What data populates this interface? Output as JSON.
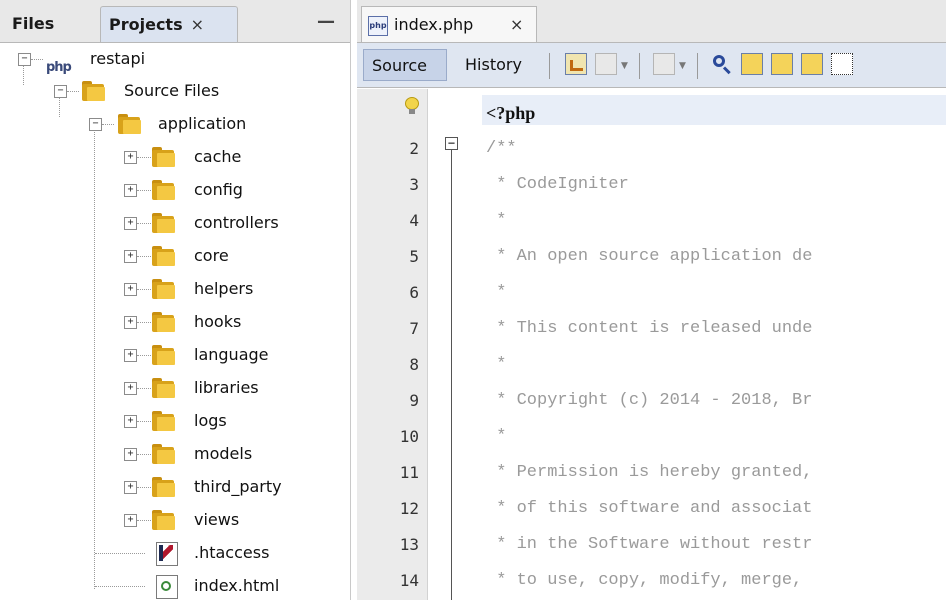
{
  "left_panel": {
    "tab_files": "Files",
    "tab_projects": "Projects",
    "tab_close": "×",
    "minimize": "—",
    "tree": {
      "project": {
        "icon_text": "php",
        "label": "restapi"
      },
      "source_files": "Source Files",
      "application": "application",
      "folders": [
        "cache",
        "config",
        "controllers",
        "core",
        "helpers",
        "hooks",
        "language",
        "libraries",
        "logs",
        "models",
        "third_party",
        "views"
      ],
      "files": [
        ".htaccess",
        "index.html"
      ]
    }
  },
  "editor": {
    "file_tab": {
      "icon_text": "php",
      "label": "index.php",
      "close": "×"
    },
    "toolbar": {
      "source": "Source",
      "history": "History"
    },
    "line_numbers": [
      "",
      "2",
      "3",
      "4",
      "5",
      "6",
      "7",
      "8",
      "9",
      "10",
      "11",
      "12",
      "13",
      "14"
    ],
    "code_lines": [
      "<?php",
      "/**",
      " * CodeIgniter",
      " *",
      " * An open source application de",
      " *",
      " * This content is released unde",
      " *",
      " * Copyright (c) 2014 - 2018, Br",
      " *",
      " * Permission is hereby granted,",
      " * of this software and associat",
      " * in the Software without restr",
      " * to use, copy, modify, merge,"
    ],
    "fold_toggle": "−"
  },
  "colors": {
    "toolbar_bg": "#dfe6f1",
    "folder": "#f4c842",
    "comment": "#9a9a9a"
  }
}
